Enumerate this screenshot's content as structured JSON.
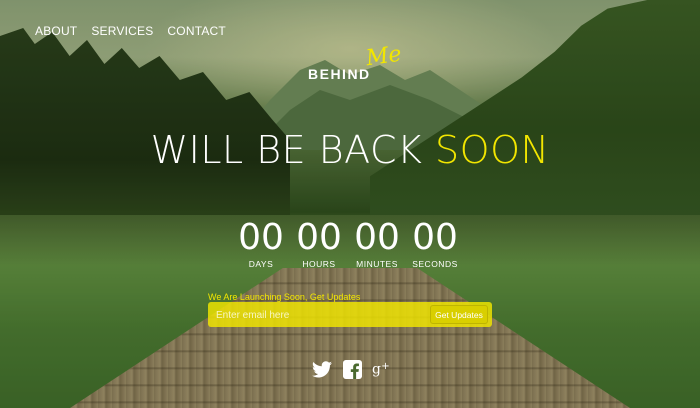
{
  "nav": {
    "items": [
      {
        "label": "ABOUT"
      },
      {
        "label": "SERVICES"
      },
      {
        "label": "CONTACT"
      }
    ]
  },
  "logo": {
    "main": "BEHIND",
    "script": "Me"
  },
  "headline": {
    "white_part": "WILL BE BACK",
    "yellow_part": "SOON"
  },
  "countdown": [
    {
      "value": "00",
      "label": "DAYS"
    },
    {
      "value": "00",
      "label": "HOURS"
    },
    {
      "value": "00",
      "label": "MINUTES"
    },
    {
      "value": "00",
      "label": "SECONDS"
    }
  ],
  "subscribe": {
    "label": "We Are Launching Soon, Get Updates",
    "placeholder": "Enter email here",
    "value": "",
    "button_label": "Get Updates"
  },
  "social": [
    {
      "icon": "twitter-icon"
    },
    {
      "icon": "facebook-icon"
    },
    {
      "icon": "google-plus-icon"
    }
  ],
  "colors": {
    "accent": "#f2e600",
    "text": "#ffffff"
  }
}
